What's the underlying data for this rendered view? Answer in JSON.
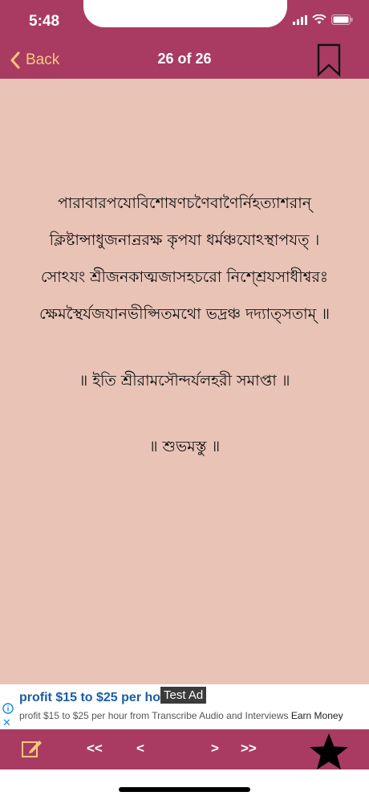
{
  "status": {
    "time": "5:48"
  },
  "nav": {
    "back_label": "Back",
    "title": "26 of 26"
  },
  "text": {
    "verse_lines": [
      "পারাবারপযোবিশোষণচণৈবাণৈর্নিহত্যাশরান্",
      "ক্লিষ্টান্সাধুজনান্ররক্ষ কৃপযা ধর্মঞ্চযোঽস্থাপযত্ ।",
      "সোঽযং শ্রীজনকাত্মজাসহচরো নিশ্শ্রেযসাধীশ্বরঃ",
      "ক্ষেমস্থৈর্যজযানভীপ্সিতমথো ভদ্রঞ্চ দদ্যাত্সতাম্ ॥"
    ],
    "colophon": "॥ ইতি শ্রীরামসৌন্দর্যলহরী সমাপ্তা ॥",
    "blessing": "॥ শুভমস্তু ॥"
  },
  "ad": {
    "headline": "profit $15 to $25 per ho",
    "label": "Test Ad",
    "body": "profit $15 to $25 per hour from Transcribe Audio and Interviews",
    "cta": "Earn Money"
  },
  "toolbar": {
    "first_label": "<<",
    "prev_label": "<",
    "next_label": ">",
    "last_label": ">>"
  },
  "colors": {
    "accent": "#a93b62",
    "background": "#e8c3b6",
    "back_tint": "#f6c87d"
  }
}
